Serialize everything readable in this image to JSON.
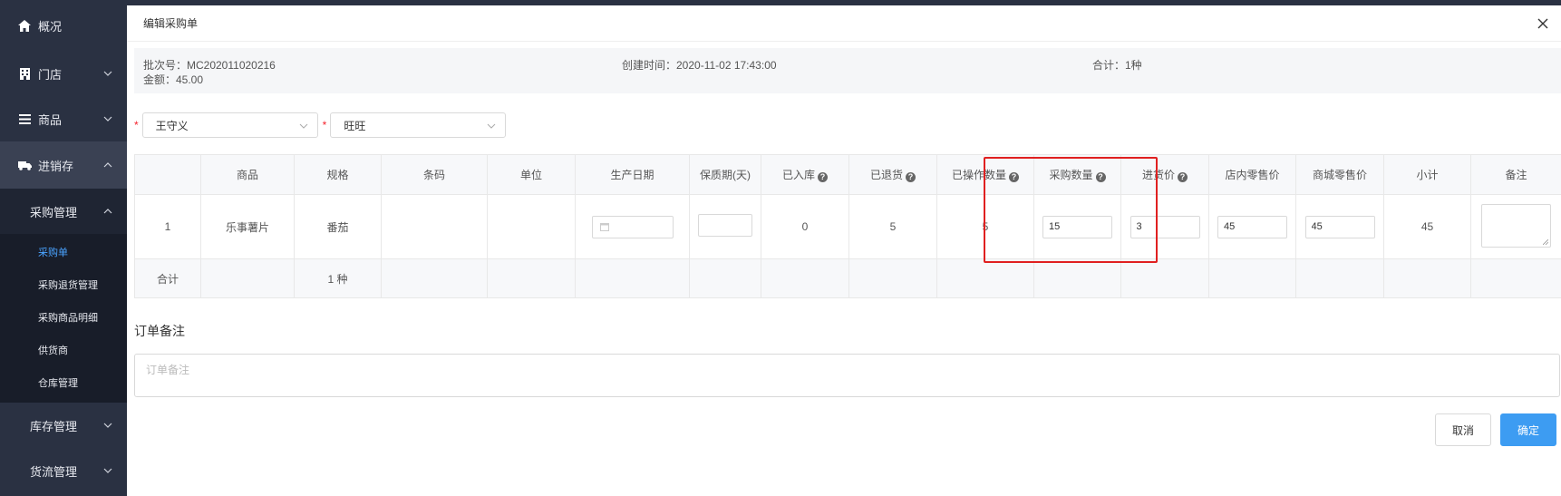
{
  "sidebar": {
    "items": [
      {
        "label": "概况",
        "icon": "home-icon"
      },
      {
        "label": "门店",
        "icon": "store-icon"
      },
      {
        "label": "商品",
        "icon": "list-icon"
      },
      {
        "label": "进销存",
        "icon": "truck-icon"
      }
    ],
    "purchase_mgmt": {
      "label": "采购管理",
      "sub": [
        "采购单",
        "采购退货管理",
        "采购商品明细",
        "供货商",
        "仓库管理"
      ]
    },
    "groups": [
      "库存管理",
      "货流管理"
    ]
  },
  "dialog": {
    "title": "编辑采购单",
    "info": {
      "batch": "批次号：MC202011020216",
      "created": "创建时间：2020-11-02 17:43:00",
      "total": "合计：1种",
      "amount": "金额：45.00"
    },
    "selects": {
      "operator": "王守义",
      "supplier": "旺旺"
    },
    "table": {
      "headers": [
        "",
        "商品",
        "规格",
        "条码",
        "单位",
        "生产日期",
        "保质期(天)",
        "已入库",
        "已退货",
        "已操作数量",
        "采购数量",
        "进货价",
        "店内零售价",
        "商城零售价",
        "小计",
        "备注"
      ],
      "row": {
        "index": "1",
        "product": "乐事薯片",
        "spec": "番茄",
        "barcode": "",
        "unit": "",
        "stocked": "0",
        "returned": "5",
        "operated": "5",
        "qty": "15",
        "price": "3",
        "store_price": "45",
        "mall_price": "45",
        "subtotal": "45"
      },
      "summary": {
        "label": "合计",
        "kinds": "1 种"
      }
    },
    "remark": {
      "title": "订单备注",
      "placeholder": "订单备注"
    },
    "buttons": {
      "cancel": "取消",
      "ok": "确定"
    }
  },
  "colors": {
    "sidebar_bg": "#2a3142",
    "accent": "#3d9cf2",
    "highlight": "#e02020"
  }
}
